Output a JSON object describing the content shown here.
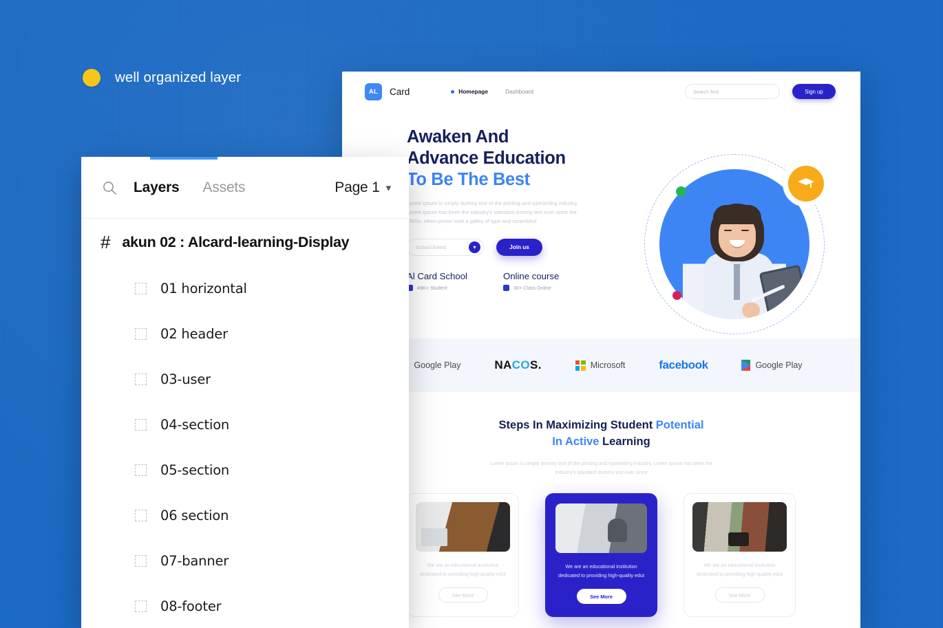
{
  "caption": {
    "text": "well organized layer",
    "dot_color": "#f6c719"
  },
  "theme": {
    "background": "#1568c8",
    "primary": "#2a22c8",
    "accent_blue": "#3d85f5",
    "yellow": "#f7ab18",
    "green": "#27b459",
    "pink": "#d41f5c"
  },
  "layers_panel": {
    "search_icon": "search-icon",
    "tabs": [
      {
        "label": "Layers",
        "active": true
      },
      {
        "label": "Assets",
        "active": false
      }
    ],
    "page_selector": {
      "label": "Page 1",
      "chevron": "chevron-down-icon"
    },
    "group": {
      "icon": "hash-icon",
      "name": "akun 02 : Alcard-learning-Display"
    },
    "layers": [
      {
        "icon": "frame-icon",
        "name": "01 horizontal"
      },
      {
        "icon": "frame-icon",
        "name": "02 header"
      },
      {
        "icon": "frame-icon",
        "name": "03-user"
      },
      {
        "icon": "frame-icon",
        "name": "04-section"
      },
      {
        "icon": "frame-icon",
        "name": "05-section"
      },
      {
        "icon": "frame-icon",
        "name": "06 section"
      },
      {
        "icon": "frame-icon",
        "name": "07-banner"
      },
      {
        "icon": "frame-icon",
        "name": "08-footer"
      }
    ]
  },
  "mockup": {
    "header": {
      "logo_text": "AL",
      "brand_name": "Card",
      "nav": [
        {
          "label": "Homepage",
          "active": true
        },
        {
          "label": "Dashboard",
          "active": false
        }
      ],
      "search_placeholder": "Search find",
      "signup_label": "Sign up"
    },
    "hero": {
      "title_line1": "Awaken And",
      "title_line2": "Advance Education",
      "title_line3": "To Be The Best",
      "paragraph": "Lorem Ipsum is simply dummy text of the printing and typesetting industry. Lorem Ipsum has been the industry's standard dummy text ever since the 1500s, when printer took a galley of type and scrambled",
      "select_value": "School linked",
      "select_chevron": "chevron-down-icon",
      "cta_label": "Join us",
      "stats": [
        {
          "title": "Al Card School",
          "sub": "49K+ Student",
          "icon": "book-icon"
        },
        {
          "title": "Online course",
          "sub": "30+ Class Online",
          "icon": "book-icon"
        }
      ],
      "art": {
        "badge_icon": "graduation-cap-icon",
        "photo_alt": "smiling-student-photo"
      }
    },
    "logos_band": [
      {
        "name": "Google Play",
        "icon": "google-play-icon"
      },
      {
        "name": "NACOS",
        "icon": "nacos-logo"
      },
      {
        "name": "Microsoft",
        "icon": "microsoft-icon"
      },
      {
        "name": "facebook",
        "icon": "facebook-logo"
      },
      {
        "name": "Google Play",
        "icon": "google-play-icon"
      }
    ],
    "steps": {
      "title_part1": "Steps In Maximizing Student ",
      "title_accent1": "Potential",
      "title_accent2": "In Active ",
      "title_part2": "Learning",
      "subtitle": "Lorem Ipsum is simply dummy text of the printing and typesetting industry, Lorem Ipsum has been the industry's standard dummy text ever since",
      "cards": [
        {
          "text": "We are an educational institution dedicated to providing high-quality edut",
          "button": "See More",
          "thumb": "desk-laptop-photo",
          "featured": false
        },
        {
          "text": "We are an educational institution dedicated to providing high-quality edut",
          "button": "See More",
          "thumb": "woman-on-couch-photo",
          "featured": true
        },
        {
          "text": "We are an educational institution dedicated to providing high-quality edut",
          "button": "See More",
          "thumb": "loft-workspace-photo",
          "featured": false
        }
      ]
    }
  }
}
